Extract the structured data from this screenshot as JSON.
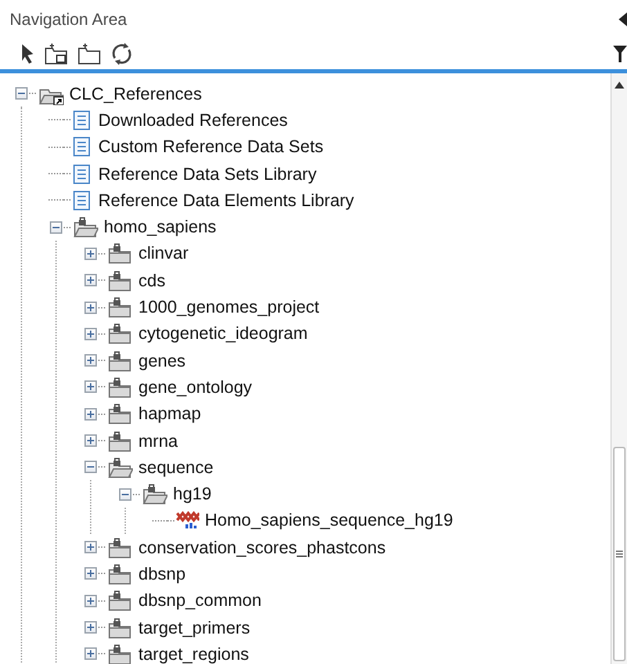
{
  "panel": {
    "title": "Navigation Area"
  },
  "tree": [
    {
      "label": "CLC_References",
      "kind": "shortcut_folder",
      "expanded": true,
      "children": [
        {
          "label": "Downloaded References",
          "kind": "document"
        },
        {
          "label": "Custom Reference Data Sets",
          "kind": "document"
        },
        {
          "label": "Reference Data Sets Library",
          "kind": "document"
        },
        {
          "label": "Reference Data Elements Library",
          "kind": "document"
        },
        {
          "label": "homo_sapiens",
          "kind": "folder",
          "expanded": true,
          "children": [
            {
              "label": "clinvar",
              "kind": "folder",
              "expanded": false
            },
            {
              "label": "cds",
              "kind": "folder",
              "expanded": false
            },
            {
              "label": "1000_genomes_project",
              "kind": "folder",
              "expanded": false
            },
            {
              "label": "cytogenetic_ideogram",
              "kind": "folder",
              "expanded": false
            },
            {
              "label": "genes",
              "kind": "folder",
              "expanded": false
            },
            {
              "label": "gene_ontology",
              "kind": "folder",
              "expanded": false
            },
            {
              "label": "hapmap",
              "kind": "folder",
              "expanded": false
            },
            {
              "label": "mrna",
              "kind": "folder",
              "expanded": false
            },
            {
              "label": "sequence",
              "kind": "folder",
              "expanded": true,
              "children": [
                {
                  "label": "hg19",
                  "kind": "folder",
                  "expanded": true,
                  "children": [
                    {
                      "label": "Homo_sapiens_sequence_hg19",
                      "kind": "sequence"
                    }
                  ]
                }
              ]
            },
            {
              "label": "conservation_scores_phastcons",
              "kind": "folder",
              "expanded": false
            },
            {
              "label": "dbsnp",
              "kind": "folder",
              "expanded": false
            },
            {
              "label": "dbsnp_common",
              "kind": "folder",
              "expanded": false
            },
            {
              "label": "target_primers",
              "kind": "folder",
              "expanded": false
            },
            {
              "label": "target_regions",
              "kind": "folder",
              "expanded": false
            }
          ]
        }
      ]
    }
  ]
}
